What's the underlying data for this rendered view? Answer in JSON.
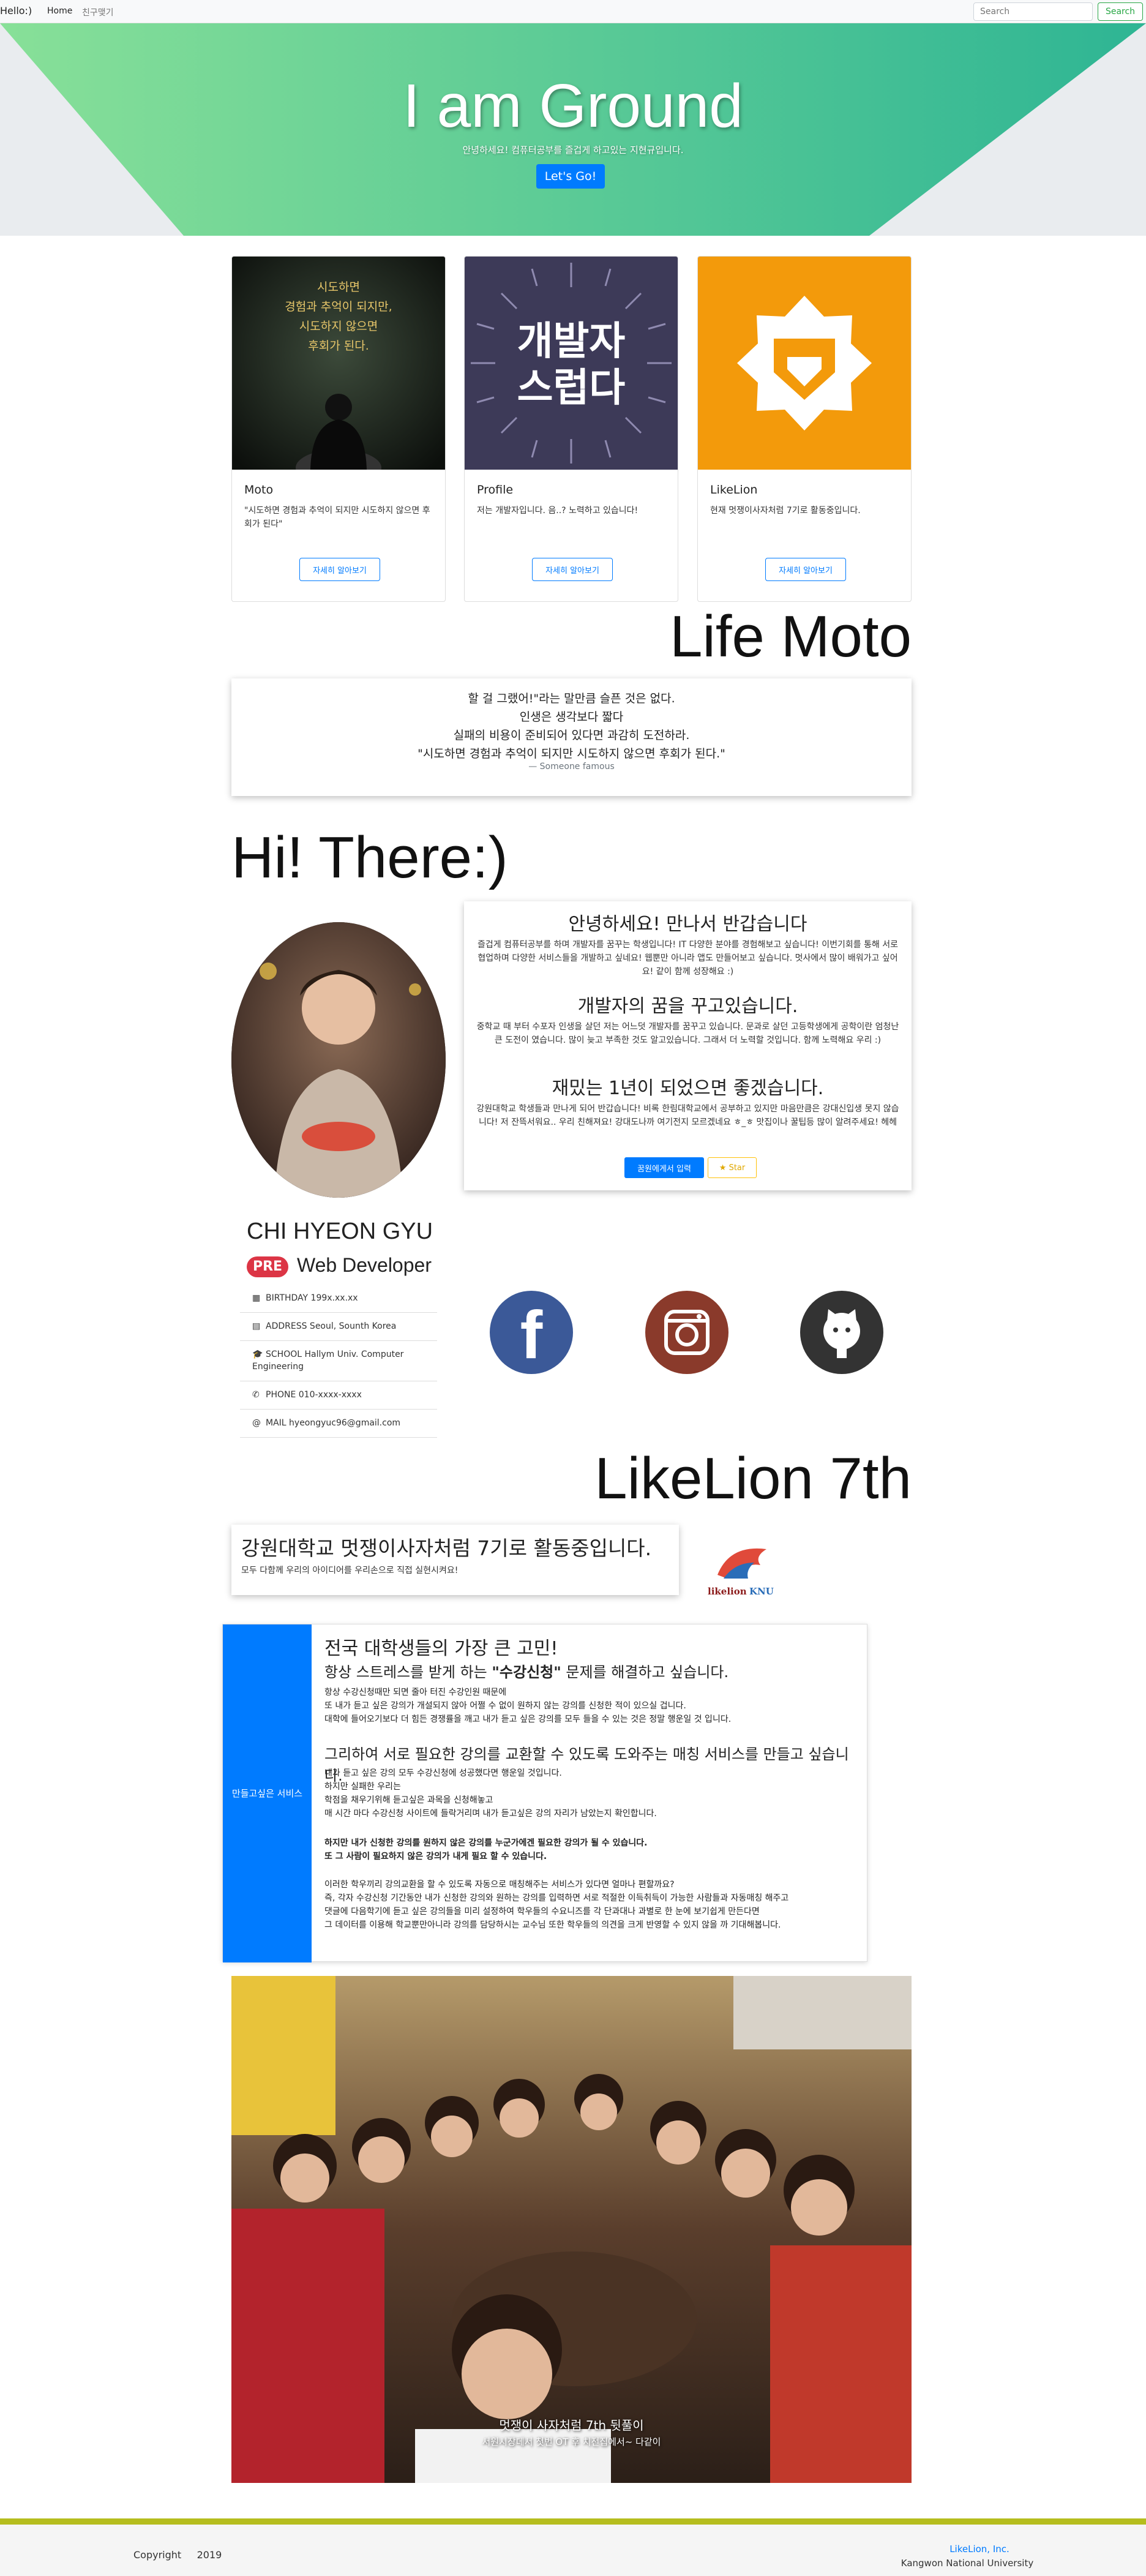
{
  "nav": {
    "brand": "Hello:)",
    "links": [
      "Home",
      "친구맺기"
    ],
    "search_placeholder": "Search",
    "search_button": "Search"
  },
  "hero": {
    "title": "I am Ground",
    "subtitle": "안녕하세요! 컴퓨터공부를 즐겁게 하고있는 지현규입니다.",
    "button": "Let's Go!"
  },
  "cards": [
    {
      "title": "Moto",
      "text": "\"시도하면 경험과 추억이 되지만 시도하지 않으면 후회가 된다\"",
      "button": "자세히 알아보기",
      "image_text": [
        "시도하면",
        "경험과 추억이 되지만,",
        "시도하지 않으면",
        "후회가 된다."
      ]
    },
    {
      "title": "Profile",
      "text": "저는 개발자입니다. 음..? 노력하고 있습니다!",
      "button": "자세히 알아보기",
      "image_text": [
        "개발자",
        "스럽다"
      ]
    },
    {
      "title": "LikeLion",
      "text": "현재 멋쟁이사자처럼 7기로 활동중입니다.",
      "button": "자세히 알아보기"
    }
  ],
  "life_moto": {
    "heading": "Life Moto",
    "lines": [
      "할 걸 그랬어!\"라는 말만큼 슬픈 것은 없다.",
      "인생은 생각보다 짧다",
      "실패의 비용이 준비되어 있다면 과감히 도전하라.",
      "\"시도하면 경험과 추억이 되지만 시도하지 않으면 후회가 된다.\""
    ],
    "footer": "— Someone famous"
  },
  "hi_heading": "Hi! There:)",
  "intro": {
    "sections": [
      {
        "title": "안녕하세요! 만나서 반갑습니다",
        "text": "즐겁게 컴퓨터공부를 하며 개발자를 꿈꾸는 학생입니다! IT 다양한 분야를 경험해보고 싶습니다! 이번기회를 통해 서로 협업하며 다양한 서비스들을 개발하고 싶네요! 웹뿐만 아니라 앱도 만들어보고 싶습니다. 멋사에서 많이 배워가고 싶어요! 같이 함께 성장해요 :)"
      },
      {
        "title": "개발자의 꿈을 꾸고있습니다.",
        "text": "중학교 때 부터 수포자 인생을 살던 저는 어느덧 개발자를 꿈꾸고 있습니다. 문과로 살던 고등학생에게 공학이란 엄청난 큰 도전이 였습니다. 많이 늦고 부족한 것도 알고있습니다. 그래서 더 노력할 것입니다. 함께 노력해요 우리 :)"
      },
      {
        "title": "재밌는 1년이 되었으면 좋겠습니다.",
        "text": "강원대학교 학생들과 만나게 되어 반갑습니다! 비록 한림대학교에서 공부하고 있지만 마음만큼은 강대신입생 못지 않습니다! 저 잔뜩서워요.. 우리 친해져요! 강대도나까 여기전지 모르겠네요 ㅎ_ㅎ 맛집이나 꿀팁등 많이 알려주세요! 헤헤"
      }
    ],
    "apply_button": "꿈원에게서 입력",
    "star_button": "Star"
  },
  "profile": {
    "name": "CHI HYEON GYU",
    "badge": "PRE",
    "role": "Web Developer",
    "info": [
      {
        "icon": "calendar-icon",
        "glyph": "▦",
        "text": "BIRTHDAY 199x.xx.xx"
      },
      {
        "icon": "address-icon",
        "glyph": "▤",
        "text": "ADDRESS Seoul, Sounth Korea"
      },
      {
        "icon": "school-icon",
        "glyph": "🎓",
        "text": "SCHOOL Hallym Univ. Computer Engineering"
      },
      {
        "icon": "phone-icon",
        "glyph": "✆",
        "text": "PHONE 010-xxxx-xxxx"
      },
      {
        "icon": "mail-icon",
        "glyph": "@",
        "text": "MAIL hyeongyuc96@gmail.com"
      }
    ]
  },
  "social": {
    "facebook": "#3b5998",
    "instagram": "#8a3a2b",
    "github": "#333333",
    "facebook_label": "f"
  },
  "likelion": {
    "heading": "LikeLion 7th",
    "title": "강원대학교 멋쟁이사자처럼 7기로 활동중입니다.",
    "subtitle": "모두 다함께 우리의 아이디어를 우리손으로 직접 실현시켜요!",
    "logo_text": "likelion",
    "logo_suffix": "KNU"
  },
  "service": {
    "side_label": "만들고싶은 서비스",
    "title": "전국 대학생들의 가장 큰 고민!",
    "subtitle_pre": "항상 스트레스를 받게 하는 ",
    "subtitle_bold": "\"수강신청\"",
    "subtitle_post": " 문제를 해결하고 싶습니다.",
    "para1": [
      "항상 수강신청때만 되면 줄아 터진 수강인원 때문에",
      "또 내가 듣고 싶은 강의가 개설되지 않아 어쩔 수 없이 원하지 않는 강의를 신청한 적이 있으실 겁니다.",
      "대학에 들어오기보다 더 힘든 경쟁률을 깨고 내가 듣고 싶은 강의를 모두 들을 수 있는 것은 정말 행운일 것 입니다."
    ],
    "title2": "그리하여 서로 필요한 강의를 교환할 수 있도록 도와주는 매칭 서비스를 만들고 싶습니다.",
    "para2": [
      "내가 듣고 싶은 강의 모두 수강신청에 성공했다면 행운일 것입니다.",
      "하지만 실패한 우리는",
      "학점을 채우기위해 듣고싶은 과목을 신청해놓고",
      "매 시간 마다 수강신청 사이트에 들락거리며 내가 듣고싶은 강의 자리가 남았는지 확인합니다."
    ],
    "bold_lines": [
      "하지만 내가 신청한 강의를 원하지 않은 강의를 누군가에겐 필요한 강의가 될 수 있습니다.",
      "또 그 사람이 필요하지 않은 강의가 내게 필요 할 수 있습니다."
    ],
    "para3": [
      "이러한 학우끼리 강의교환을 할 수 있도록 자동으로 매칭해주는 서비스가 있다면 얼마나 편할까요?",
      "즉, 각자 수강신청 기간동안 내가 신청한 강의와 원하는 강의를 입력하면 서로 적절한 이득취득이 가능한 사람들과 자동매칭 해주고",
      "댓글에 다음학기에 듣고 싶은 강의들을 미리 설정하여 학우들의 수요니즈를 각 단과대나 과별로 한 눈에 보기쉽게 만든다면",
      "그 데이터를 이용해 학교뿐만아니라 강의를 담당하시는 교수님 또한 학우들의 의견을 크게 반영할 수 있지 않을 까 기대해봅니다."
    ]
  },
  "photo": {
    "caption1": "멋쟁이 사자처럼 7th 뒷풀이",
    "caption2": "서원시장데서 첫번 OT 후 치전집에서~ 다같이"
  },
  "footer": {
    "copyright": "Copyright",
    "year": "2019",
    "company": "LikeLion, Inc.",
    "university": "Kangwon National University",
    "accent": "#b5bd1e"
  }
}
